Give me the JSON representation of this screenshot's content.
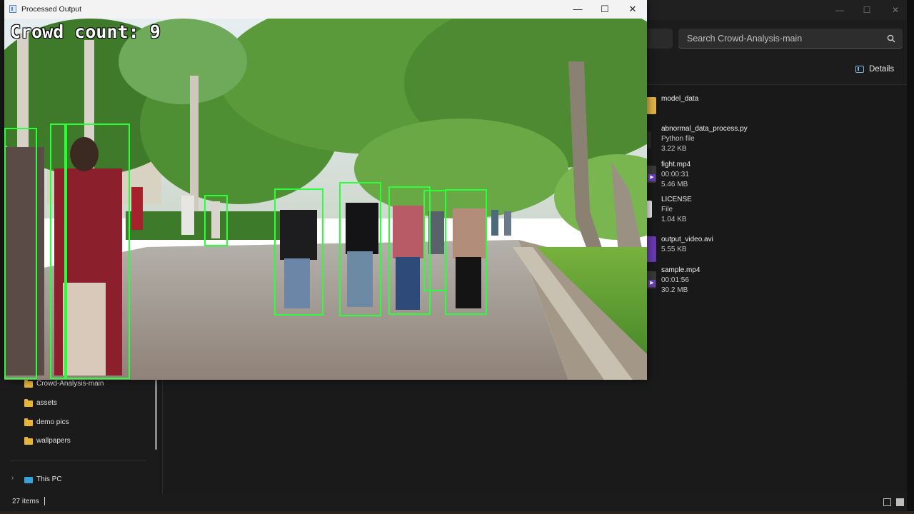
{
  "output_window": {
    "title": "Processed Output",
    "controls": {
      "minimize": "—",
      "maximize": "☐",
      "close": "✕"
    },
    "overlay": {
      "label": "Crowd count:",
      "value": 9
    },
    "detection_box_color": "#2bff3a",
    "detections": [
      {
        "id": "person-1"
      },
      {
        "id": "person-2"
      },
      {
        "id": "person-3"
      },
      {
        "id": "person-4"
      },
      {
        "id": "person-5"
      },
      {
        "id": "person-6"
      },
      {
        "id": "person-7"
      },
      {
        "id": "person-8"
      },
      {
        "id": "person-9"
      }
    ]
  },
  "explorer": {
    "search_placeholder": "Search Crowd-Analysis-main",
    "details_label": "Details",
    "files": [
      {
        "name": "model_data",
        "line2": "",
        "line3": "",
        "kind": "folder"
      },
      {
        "name": "abnormal_data_process.py",
        "line2": "Python file",
        "line3": "3.22 KB",
        "kind": "python"
      },
      {
        "name": "fight.mp4",
        "line2": "00:00:31",
        "line3": "5.46 MB",
        "kind": "video"
      },
      {
        "name": "LICENSE",
        "line2": "File",
        "line3": "1.04 KB",
        "kind": "file"
      },
      {
        "name": "output_video.avi",
        "line2": "5.55 KB",
        "line3": "",
        "kind": "avi"
      },
      {
        "name": "sample.mp4",
        "line2": "00:01:56",
        "line3": "30.2 MB",
        "kind": "video"
      }
    ],
    "nav": {
      "folders": [
        "Crowd-Analysis-main",
        "assets",
        "demo pics",
        "wallpapers"
      ],
      "this_pc": "This PC"
    },
    "status": "27 items"
  }
}
